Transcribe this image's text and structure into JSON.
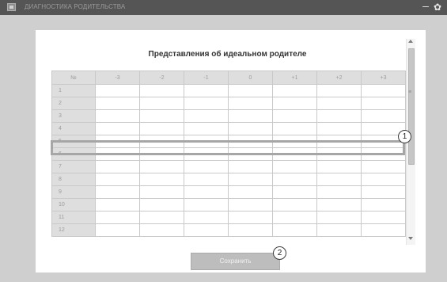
{
  "window": {
    "title": "ДИАГНОСТИКА РОДИТЕЛЬСТВА",
    "icon": "app-icon",
    "min_symbol": "–",
    "gear_symbol": "✿"
  },
  "table": {
    "title": "Представления об идеальном родителе",
    "header_num": "№",
    "columns": [
      "-3",
      "-2",
      "-1",
      "0",
      "+1",
      "+2",
      "+3"
    ],
    "rows": [
      "1",
      "2",
      "3",
      "4",
      "5",
      "6",
      "7",
      "8",
      "9",
      "10",
      "11",
      "12"
    ],
    "highlighted_row": "5"
  },
  "scrollbar": {
    "grip_symbol": "≡",
    "position": 0
  },
  "footer": {
    "save_label": "Сохранить"
  },
  "callouts": {
    "one": "1",
    "two": "2"
  },
  "colors": {
    "titlebar": "#555555",
    "background": "#cfcfcf",
    "header_cell": "#dedede",
    "highlight": "#a6a6a6",
    "button": "#bdbdbd"
  }
}
